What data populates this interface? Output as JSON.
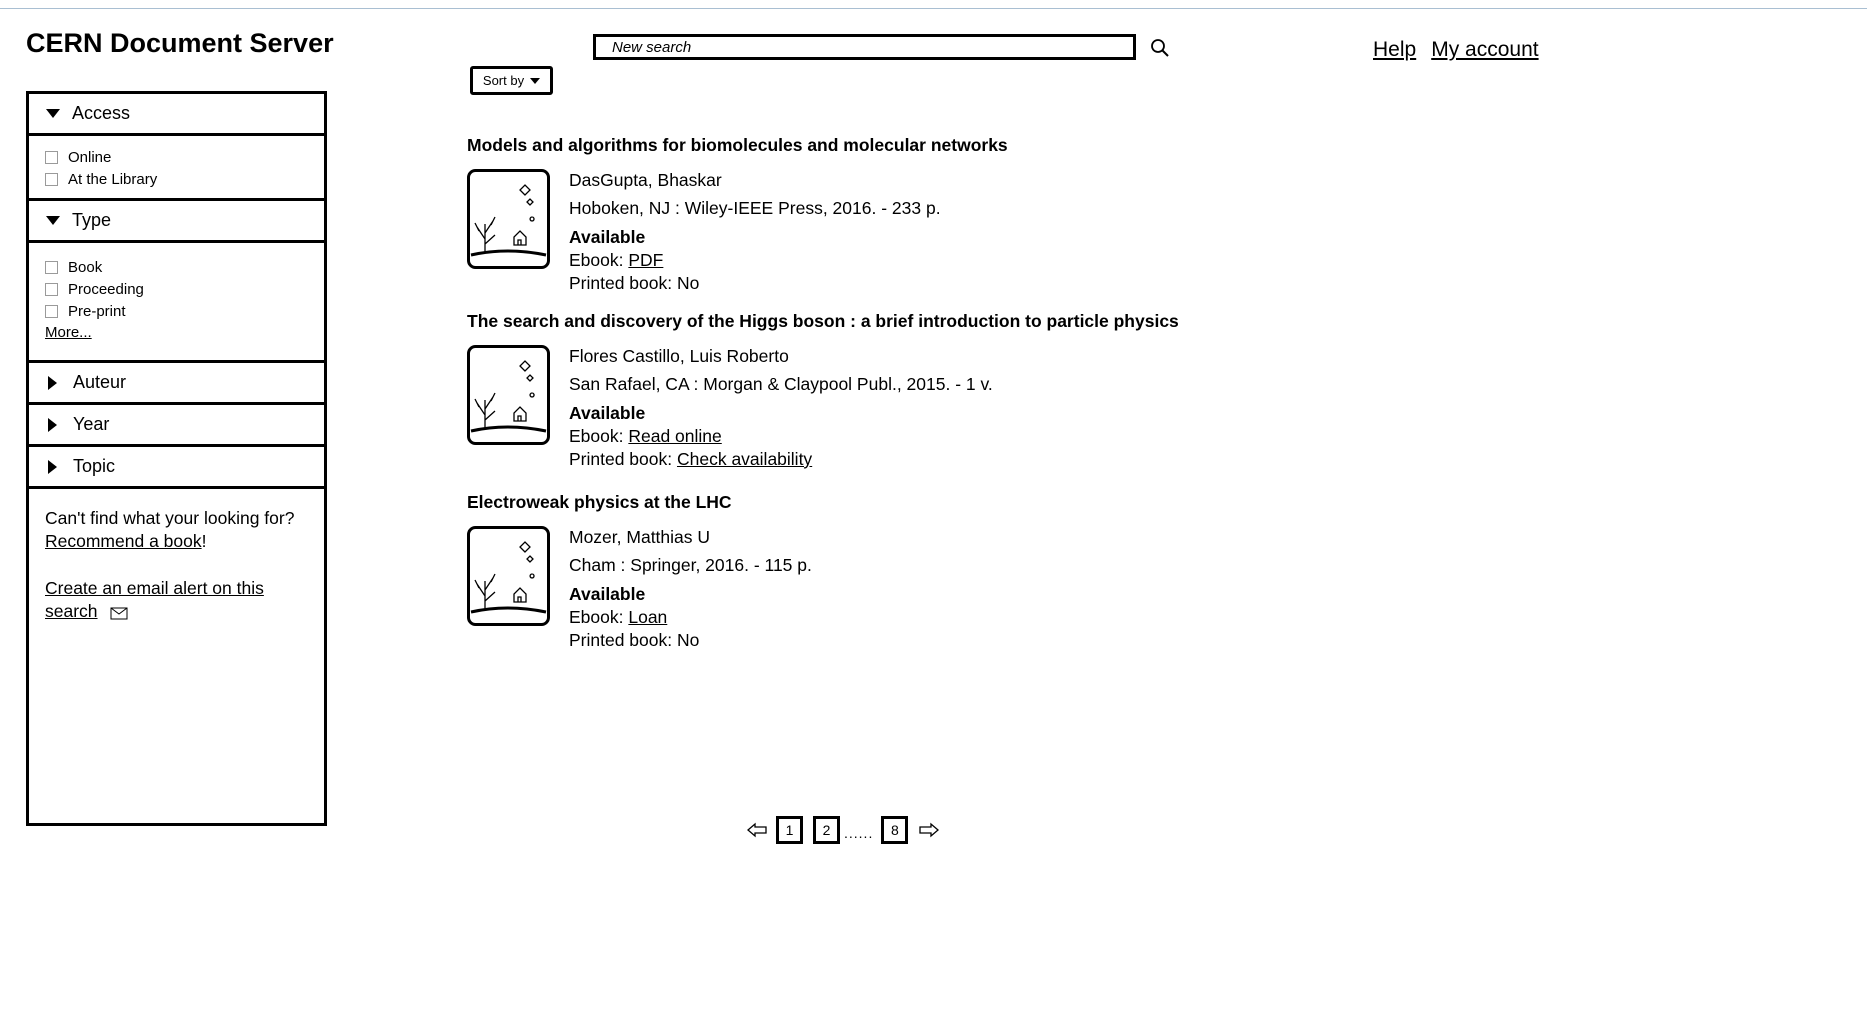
{
  "app": {
    "title": "CERN Document Server"
  },
  "search": {
    "placeholder": "New search",
    "sort_label": "Sort by"
  },
  "header_links": {
    "help": "Help",
    "account": "My account"
  },
  "sidebar": {
    "access": {
      "label": "Access",
      "options": [
        "Online",
        "At the Library"
      ]
    },
    "type": {
      "label": "Type",
      "options": [
        "Book",
        "Proceeding",
        "Pre-print"
      ],
      "more": "More..."
    },
    "collapsed": [
      "Auteur",
      "Year",
      "Topic"
    ],
    "help": {
      "question": "Can't find what your looking for?",
      "recommend_link": "Recommend a book",
      "recommend_suffix": "!",
      "alert_link_line1": "Create an email alert on this",
      "alert_link_line2": "search"
    }
  },
  "results": [
    {
      "title": "Models and algorithms for biomolecules and molecular networks",
      "author": "DasGupta, Bhaskar",
      "publication": "Hoboken, NJ : Wiley-IEEE Press, 2016. - 233 p.",
      "availability": "Available",
      "ebook_label": "Ebook: ",
      "ebook_link": "PDF",
      "printed_label": "Printed book: ",
      "printed_value": "No",
      "printed_is_link": false
    },
    {
      "title": "The search and discovery of the Higgs boson : a brief introduction to particle physics",
      "author": "Flores Castillo, Luis Roberto",
      "publication": "San Rafael, CA : Morgan & Claypool Publ., 2015. - 1 v.",
      "availability": "Available",
      "ebook_label": "Ebook: ",
      "ebook_link": "Read online",
      "printed_label": "Printed book: ",
      "printed_value": "Check availability",
      "printed_is_link": true
    },
    {
      "title": "Electroweak physics at the LHC",
      "author": "Mozer, Matthias U",
      "publication": "Cham : Springer, 2016. - 115 p.",
      "availability": "Available",
      "ebook_label": "Ebook: ",
      "ebook_link": "Loan",
      "printed_label": "Printed book: ",
      "printed_value": "No",
      "printed_is_link": false
    }
  ],
  "pagination": {
    "pages": [
      "1",
      "2",
      "8"
    ],
    "ellipsis": "......"
  },
  "icons": {
    "search": "magnifier-icon",
    "email": "envelope-icon",
    "cover": "book-cover-placeholder-icon",
    "prev": "arrow-left-icon",
    "next": "arrow-right-icon"
  }
}
